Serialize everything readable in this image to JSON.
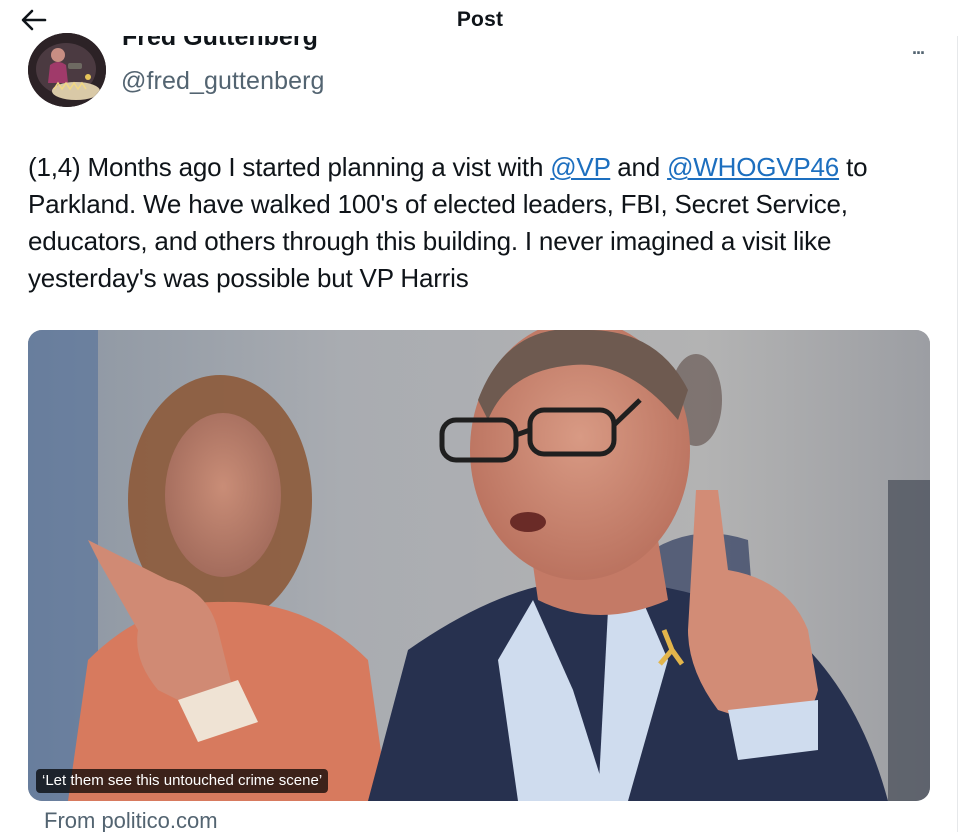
{
  "header": {
    "title": "Post",
    "back_icon": "arrow-left-icon"
  },
  "author": {
    "display_name": "Fred Guttenberg",
    "handle": "@fred_guttenberg",
    "avatar_icon": "avatar-photo"
  },
  "more_label": "...",
  "tweet": {
    "text_1": "(1,4) Months ago I started planning a vist with ",
    "mention_1": "@VP",
    "text_2": " and ",
    "mention_2": "@WHOGVP46",
    "text_3": " to Parkland.  We have walked 100's of elected leaders, FBI, Secret Service, educators, and others through this building.  I never imagined a visit like yesterday's was possible but VP Harris"
  },
  "card": {
    "caption": "‘Let them see this untouched crime scene’",
    "source": "From politico.com"
  },
  "colors": {
    "link": "#1d6fbf",
    "secondary_text": "#536471"
  }
}
